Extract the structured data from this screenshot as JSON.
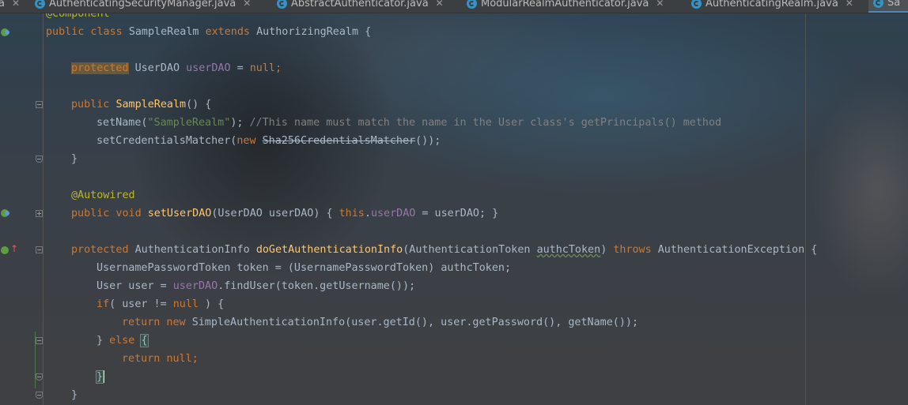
{
  "tabs": [
    {
      "label": "a",
      "active": false
    },
    {
      "label": "AuthenticatingSecurityManager.java",
      "active": false
    },
    {
      "label": "AbstractAuthenticator.java",
      "active": false
    },
    {
      "label": "ModularRealmAuthenticator.java",
      "active": false
    },
    {
      "label": "AuthenticatingRealm.java",
      "active": false
    },
    {
      "label": "Sa",
      "active": true
    }
  ],
  "code": {
    "l0": "@Component",
    "l1_kw1": "public class ",
    "l1_name": "SampleRealm ",
    "l1_kw2": "extends ",
    "l1_rest": "AuthorizingRealm {",
    "l3_kw": "protected",
    "l3_type": " UserDAO ",
    "l3_field": "userDAO",
    "l3_eq": " = ",
    "l3_null": "null",
    "l3_semi": ";",
    "l5_kw": "public ",
    "l5_fn": "SampleRealm",
    "l5_rest": "() {",
    "l6_a": "setName(",
    "l6_str": "\"SampleRealm\"",
    "l6_b": "); ",
    "l6_cmt": "//This name must match the name in the User class's getPrincipals() method",
    "l7_a": "setCredentialsMatcher(",
    "l7_kw": "new ",
    "l7_strike": "Sha256CredentialsMatcher",
    "l7_b": "());",
    "l8": "}",
    "l10": "@Autowired",
    "l11_kw": "public void ",
    "l11_fn": "setUserDAO",
    "l11_a": "(UserDAO userDAO) { ",
    "l11_this": "this",
    "l11_dot": ".",
    "l11_fld": "userDAO",
    "l11_b": " = userDAO; }",
    "l13_kw": "protected ",
    "l13_type": "AuthenticationInfo ",
    "l13_fn": "doGetAuthenticationInfo",
    "l13_a": "(AuthenticationToken ",
    "l13_param": "authcToken",
    "l13_b": ") ",
    "l13_throws": "throws ",
    "l13_c": "AuthenticationException {",
    "l14": "UsernamePasswordToken token = (UsernamePasswordToken) authcToken;",
    "l15_a": "User user = ",
    "l15_fld": "userDAO",
    "l15_b": ".findUser(token.getUsername());",
    "l16_kw": "if",
    "l16_a": "( user != ",
    "l16_null": "null",
    "l16_b": " ) {",
    "l17_kw": "return new ",
    "l17_a": "SimpleAuthenticationInfo(user.getId(), user.getPassword(), getName());",
    "l18_a": "} ",
    "l18_kw": "else ",
    "l18_brace": "{",
    "l19_kw": "return ",
    "l19_null": "null",
    "l19_semi": ";",
    "l20": "}",
    "l21": "}"
  },
  "icons": {
    "class_gutter": "implements-icon",
    "method_gutter": "override-icon",
    "tab_icon": "java-class-icon",
    "close": "close-icon"
  },
  "colors": {
    "keyword": "#cc7832",
    "function": "#ffc66d",
    "field": "#9876aa",
    "string": "#6a8759",
    "comment": "#808080",
    "annotation": "#bbb529",
    "text": "#a9b7c6"
  }
}
